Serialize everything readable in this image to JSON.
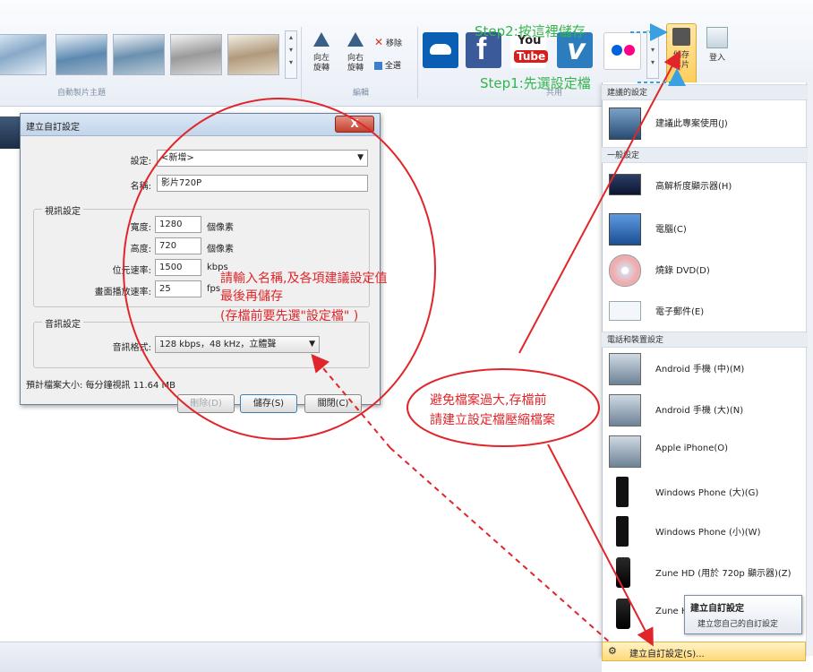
{
  "ribbon": {
    "group_themes": "自動製片主題",
    "group_edit": "編輯",
    "group_share": "共用",
    "rotate_left": "向左\n旋轉",
    "rotate_right": "向右\n旋轉",
    "remove": "移除",
    "select_all": "全選",
    "save_movie": "儲存\n影片",
    "signin": "登入",
    "youtube_top": "You",
    "youtube_bottom": "Tube",
    "vimeo": "v",
    "facebook": "f"
  },
  "annotations": {
    "step2": "Step2:按這裡儲存",
    "step1": "Step1:先選設定檔",
    "dialog_note_1": "請輸入名稱,及各項建議設定值",
    "dialog_note_2": "最後再儲存",
    "dialog_note_3": "(存檔前要先選\"設定檔\" )",
    "bottom_note_1": "避免檔案過大,存檔前",
    "bottom_note_2": "請建立設定檔壓縮檔案"
  },
  "dialog": {
    "title": "建立自訂設定",
    "close": "X",
    "setting_label": "設定:",
    "setting_value": "<新增>",
    "name_label": "名稱:",
    "name_value": "影片720P",
    "video_legend": "視訊設定",
    "width_label": "寬度:",
    "width_value": "1280",
    "width_unit": "個像素",
    "height_label": "高度:",
    "height_value": "720",
    "height_unit": "個像素",
    "bitrate_label": "位元速率:",
    "bitrate_value": "1500",
    "bitrate_unit": "kbps",
    "fps_label": "畫面播放速率:",
    "fps_value": "25",
    "fps_unit": "fps",
    "audio_legend": "音訊設定",
    "audio_label": "音訊格式:",
    "audio_value": "128 kbps，48 kHz，立體聲",
    "estimate": "預計檔案大小: 每分鐘視訊 11.64 MB",
    "delete_btn": "刪除(D)",
    "save_btn": "儲存(S)",
    "close_btn": "關閉(C)"
  },
  "menu": {
    "head_recommended": "建議的設定",
    "recommended_item": "建議此專案使用(J)",
    "head_general": "一般設定",
    "general_items": [
      "高解析度顯示器(H)",
      "電腦(C)",
      "燒錄 DVD(D)",
      "電子郵件(E)"
    ],
    "head_devices": "電話和裝置設定",
    "device_items": [
      "Android 手機 (中)(M)",
      "Android 手機 (大)(N)",
      "Apple iPhone(O)",
      "Windows Phone (大)(G)",
      "Windows Phone (小)(W)",
      "Zune HD (用於 720p 顯示器)(Z)",
      "Zune H"
    ],
    "tooltip_title": "建立自訂設定",
    "tooltip_desc": "建立您自己的自訂設定",
    "bottom_item": "建立自訂設定(S)..."
  }
}
